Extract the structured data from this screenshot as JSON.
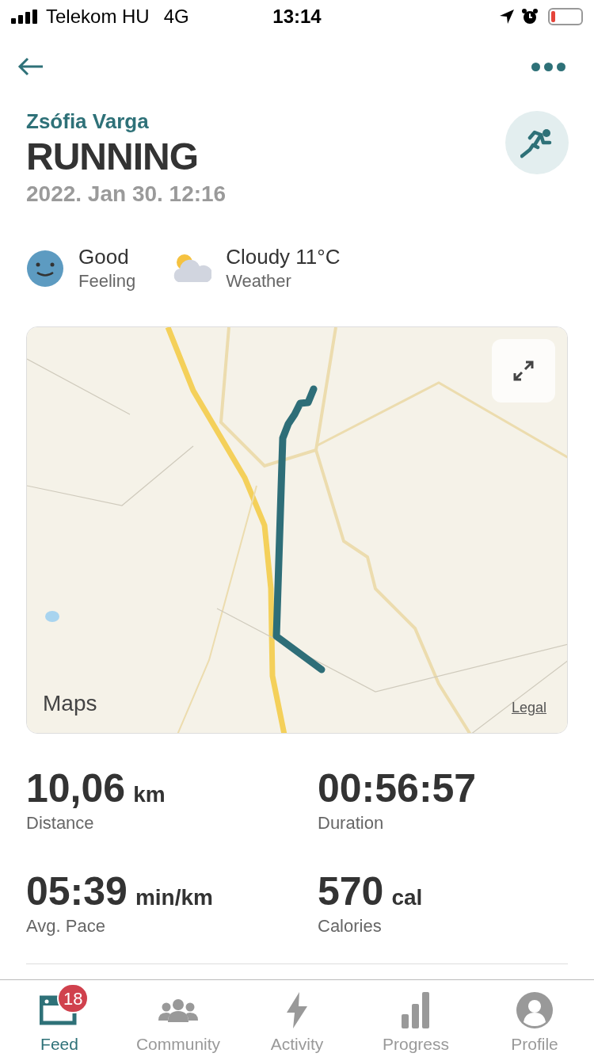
{
  "status_bar": {
    "carrier": "Telekom HU",
    "network": "4G",
    "time": "13:14"
  },
  "header": {
    "athlete": "Zsófia Varga",
    "activity": "RUNNING",
    "date": "2022. Jan 30. 12:16"
  },
  "conditions": [
    {
      "kind": "feeling",
      "value": "Good",
      "label": "Feeling"
    },
    {
      "kind": "weather",
      "value": "Cloudy 11°C",
      "label": "Weather"
    }
  ],
  "map": {
    "attribution": "Maps",
    "legal": "Legal"
  },
  "stats": [
    {
      "value": "10,06",
      "unit": "km",
      "label": "Distance"
    },
    {
      "value": "00:56:57",
      "label": "Duration"
    },
    {
      "value": "05:39",
      "unit": "min/km",
      "label": "Avg. Pace"
    },
    {
      "value": "570",
      "unit": "cal",
      "label": "Calories"
    }
  ],
  "tabs": [
    {
      "label": "Feed",
      "selected": true,
      "badge": "18"
    },
    {
      "label": "Community",
      "selected": false
    },
    {
      "label": "Activity",
      "selected": false
    },
    {
      "label": "Progress",
      "selected": false
    },
    {
      "label": "Profile",
      "selected": false
    }
  ]
}
